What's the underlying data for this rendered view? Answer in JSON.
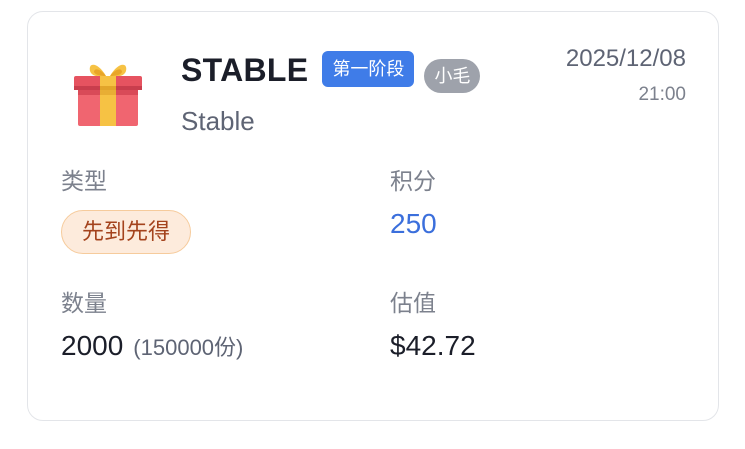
{
  "card": {
    "token_name": "STABLE",
    "phase_badge": "第一阶段",
    "owner_badge": "小毛",
    "subtitle": "Stable",
    "date": "2025/12/08",
    "time": "21:00",
    "icon": "gift-icon"
  },
  "fields": {
    "type_label": "类型",
    "type_value": "先到先得",
    "points_label": "积分",
    "points_value": "250",
    "quantity_label": "数量",
    "quantity_value": "2000",
    "quantity_shares": "(150000份)",
    "estimate_label": "估值",
    "estimate_value": "$42.72"
  },
  "colors": {
    "phase_badge_bg": "#3f7ce8",
    "owner_badge_bg": "#9ea2ab",
    "points_value": "#3b6fdc",
    "type_tag_bg": "#fdebdc",
    "type_tag_text": "#a4431d"
  }
}
